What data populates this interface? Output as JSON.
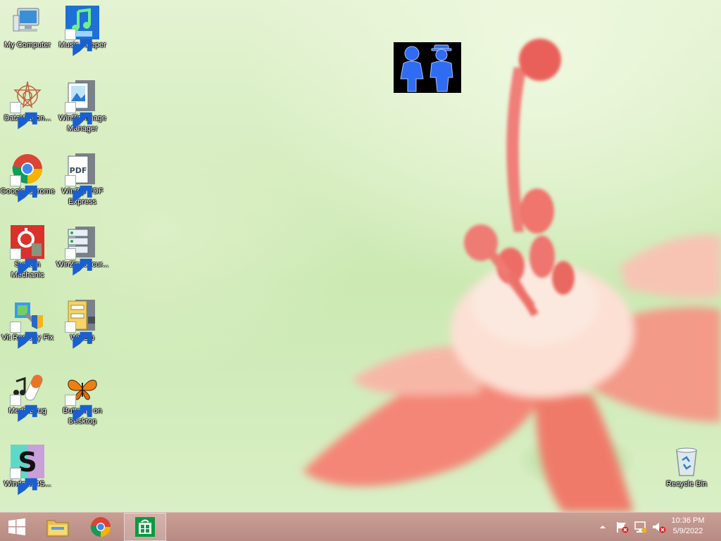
{
  "desktop": {
    "icons": [
      {
        "label": "My Computer"
      },
      {
        "label": "Music Keeper"
      },
      {
        "label": "DataWagon..."
      },
      {
        "label": "WinZip Image Manager"
      },
      {
        "label": "Google Chrome"
      },
      {
        "label": "WinZip PDF Express"
      },
      {
        "label": "System Mechanic"
      },
      {
        "label": "WinZip Secur..."
      },
      {
        "label": "Vit Registry Fix"
      },
      {
        "label": "WinZip"
      },
      {
        "label": "MediaDrug"
      },
      {
        "label": "Butterfly on Desktop"
      },
      {
        "label": "Windows4S..."
      },
      {
        "label": "Recycle Bin"
      }
    ]
  },
  "taskbar": {
    "start": "windows-logo-icon",
    "pinned": [
      "file-explorer-icon",
      "chrome-icon",
      "store-icon"
    ],
    "tray_icons": [
      "show-hidden-icons-icon",
      "action-center-flag-icon",
      "network-icon",
      "volume-muted-icon"
    ],
    "clock": {
      "time": "10:36 PM",
      "date": "5/9/2022"
    }
  }
}
